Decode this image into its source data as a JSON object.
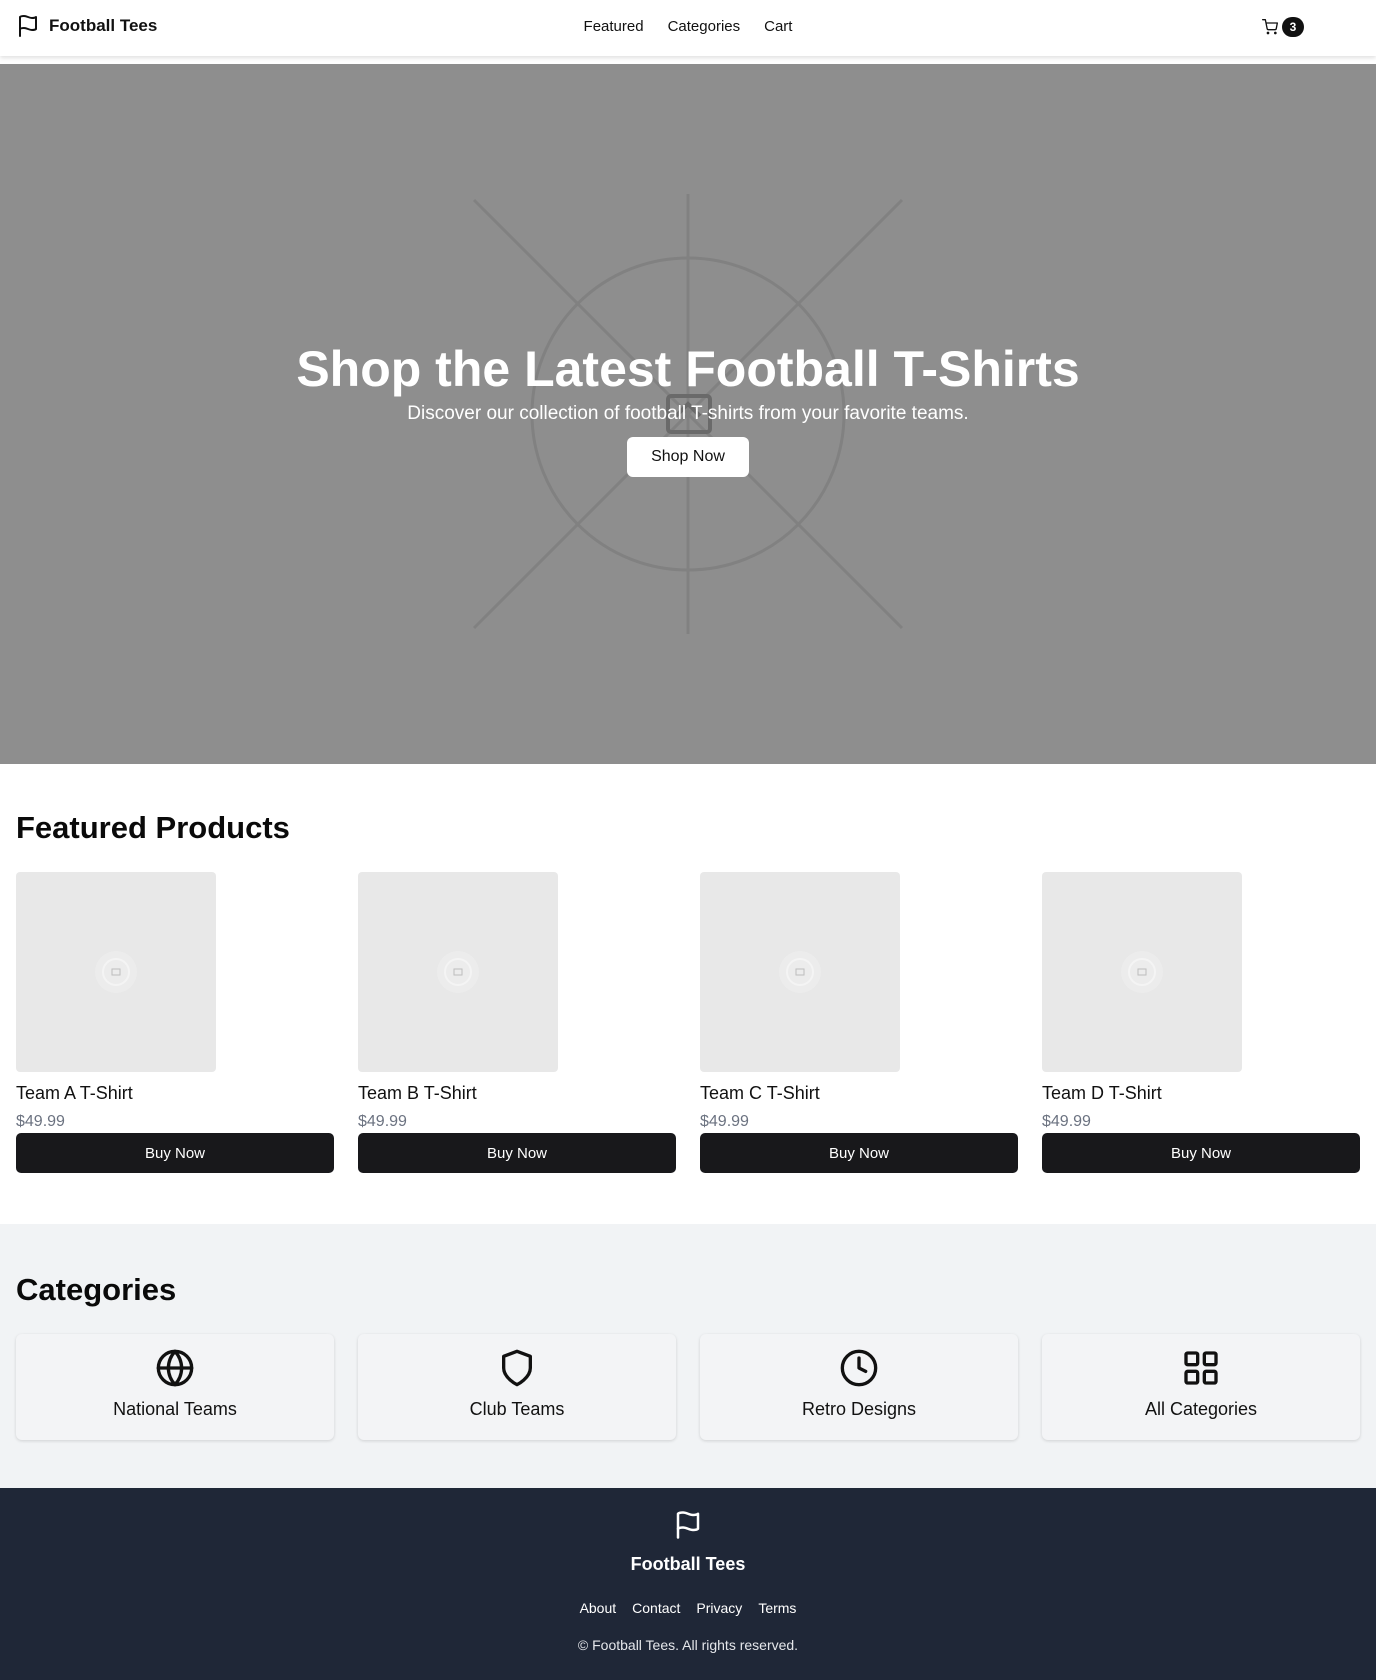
{
  "header": {
    "brand_icon": "flag-icon",
    "brand": "Football Tees",
    "nav": [
      "Featured",
      "Categories",
      "Cart"
    ],
    "cart_icon": "cart-icon",
    "cart_count": "3"
  },
  "hero": {
    "title": "Shop the Latest Football T-Shirts",
    "subtitle": "Discover our collection of football T-shirts from your favorite teams.",
    "cta": "Shop Now",
    "background": "#8e8e8e"
  },
  "featured": {
    "title": "Featured Products",
    "products": [
      {
        "name": "Team A T-Shirt",
        "price": "$49.99",
        "cta": "Buy Now"
      },
      {
        "name": "Team B T-Shirt",
        "price": "$49.99",
        "cta": "Buy Now"
      },
      {
        "name": "Team C T-Shirt",
        "price": "$49.99",
        "cta": "Buy Now"
      },
      {
        "name": "Team D T-Shirt",
        "price": "$49.99",
        "cta": "Buy Now"
      }
    ]
  },
  "categories": {
    "title": "Categories",
    "items": [
      {
        "label": "National Teams",
        "icon": "globe-icon"
      },
      {
        "label": "Club Teams",
        "icon": "shield-icon"
      },
      {
        "label": "Retro Designs",
        "icon": "clock-icon"
      },
      {
        "label": "All Categories",
        "icon": "grid-icon"
      }
    ]
  },
  "footer": {
    "brand": "Football Tees",
    "links": [
      "About",
      "Contact",
      "Privacy",
      "Terms"
    ],
    "copyright": "© Football Tees. All rights reserved."
  },
  "colors": {
    "dark_button": "#18181b",
    "footer_bg": "#1f2737",
    "categories_bg": "#f1f3f5",
    "price_text": "#6b7280"
  }
}
